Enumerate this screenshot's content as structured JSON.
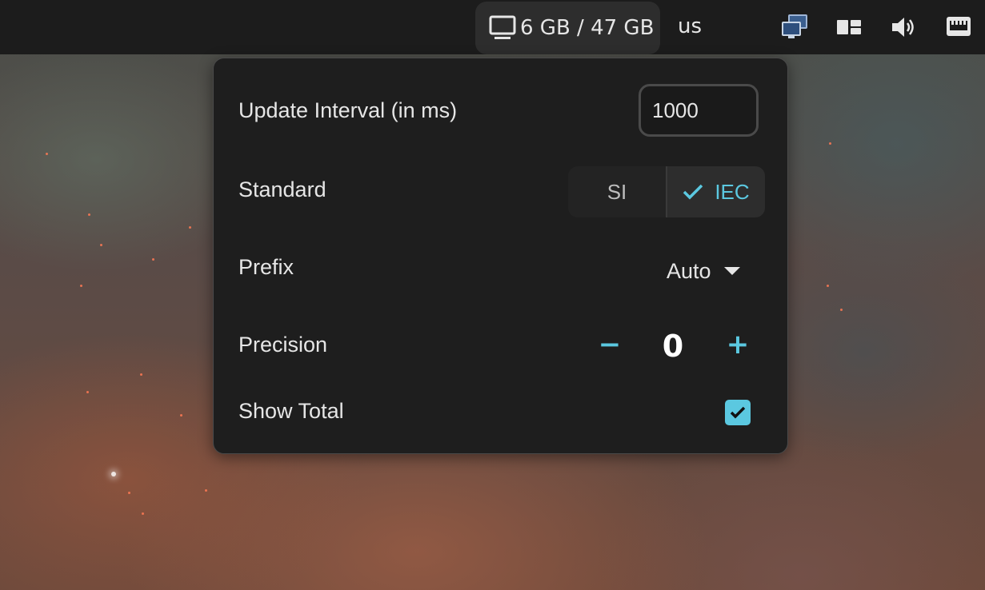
{
  "topbar": {
    "memory_indicator": {
      "icon": "monitor-icon",
      "text": "6 GB / 47 GB"
    },
    "keyboard_layout": "us",
    "tray_icons": [
      "network-manager-icon",
      "window-layout-icon",
      "volume-icon",
      "ethernet-icon"
    ]
  },
  "popup": {
    "update_interval": {
      "label": "Update Interval (in ms)",
      "value": "1000"
    },
    "standard": {
      "label": "Standard",
      "options": [
        "SI",
        "IEC"
      ],
      "selected": "IEC"
    },
    "prefix": {
      "label": "Prefix",
      "selected": "Auto"
    },
    "precision": {
      "label": "Precision",
      "decrement": "−",
      "value": "0",
      "increment": "+"
    },
    "show_total": {
      "label": "Show Total",
      "checked": true
    }
  },
  "colors": {
    "accent": "#5bc8e0",
    "panel_bg": "#1e1e1e",
    "topbar_bg": "#1c1c1c"
  }
}
